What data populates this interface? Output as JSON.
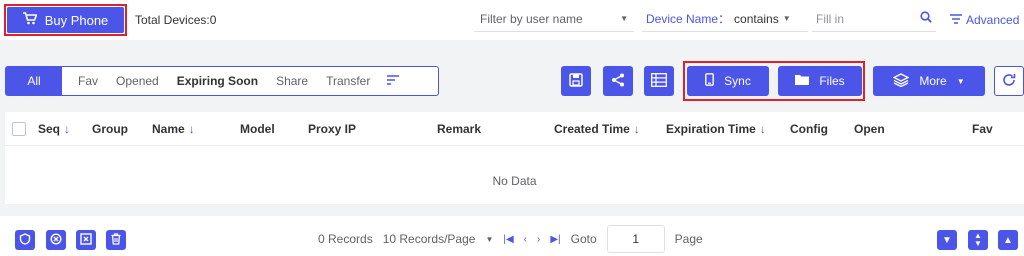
{
  "header": {
    "buy_phone_label": "Buy Phone",
    "total_devices": "Total Devices:0",
    "filter_user_placeholder": "Filter by user name",
    "field_label": "Device Name：",
    "field_operator": "contains",
    "fill_in_placeholder": "Fill in",
    "advanced_label": "Advanced"
  },
  "tabs": [
    {
      "label": "All"
    },
    {
      "label": "Fav"
    },
    {
      "label": "Opened"
    },
    {
      "label": "Expiring Soon"
    },
    {
      "label": "Share"
    },
    {
      "label": "Transfer"
    }
  ],
  "toolbar": {
    "sync_label": "Sync",
    "files_label": "Files",
    "more_label": "More"
  },
  "table": {
    "columns": [
      "Seq",
      "Group",
      "Name",
      "Model",
      "Proxy IP",
      "Remark",
      "Created Time",
      "Expiration Time",
      "Config",
      "Open",
      "Fav"
    ],
    "empty_text": "No Data"
  },
  "pagination": {
    "records": "0 Records",
    "page_size": "10 Records/Page",
    "goto_label": "Goto",
    "current_page": "1",
    "page_label": "Page"
  },
  "colors": {
    "accent": "#4b55e8",
    "highlight_border": "#e0202a"
  }
}
